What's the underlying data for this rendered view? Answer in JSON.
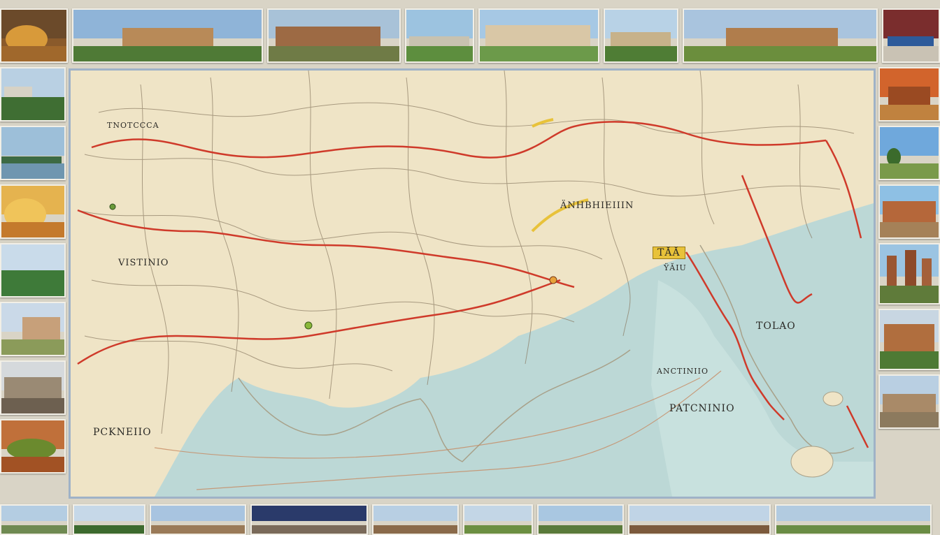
{
  "map": {
    "labels": {
      "region_north": "ÄNHBHIEIIIN",
      "badge_center": "TĂĂ",
      "west_label": "VISTINIO",
      "southwest_label": "PCKNEIIO",
      "east_label": "TOLAO",
      "south_label": "PATCNINIO",
      "sea_label": "ANCTINIIO",
      "north_small": "TNOTCCCA",
      "pin_label": "ŸĂIU"
    },
    "colors": {
      "land": "#efe4c6",
      "sea": "#bcd8d6",
      "route": "#cf3a2a",
      "road": "#7a6a52",
      "frame": "#9fb2c7"
    }
  },
  "photos": {
    "top": [
      "sunflower-food-photo",
      "mountain-hall-photo",
      "pyramid-hall-photo",
      "green-hills-photo",
      "columned-temple-photo",
      "greenhouse-photo",
      "pavilion-photo",
      "harbor-photo"
    ],
    "left": [
      "forest-photo",
      "lake-photo",
      "food-plate-photo",
      "green-hill-photo",
      "building-photo",
      "city-photo",
      "dish-photo"
    ],
    "right": [
      "desert-ruins-photo",
      "tree-photo",
      "brick-house-photo",
      "towers-photo",
      "palace-photo",
      "ruins-photo"
    ],
    "bottom": [
      "cypress-photo",
      "villa-photo",
      "tower-photo",
      "ship-photo",
      "roof-photo",
      "shrine-photo",
      "mountain-photo",
      "valley-photo"
    ]
  }
}
